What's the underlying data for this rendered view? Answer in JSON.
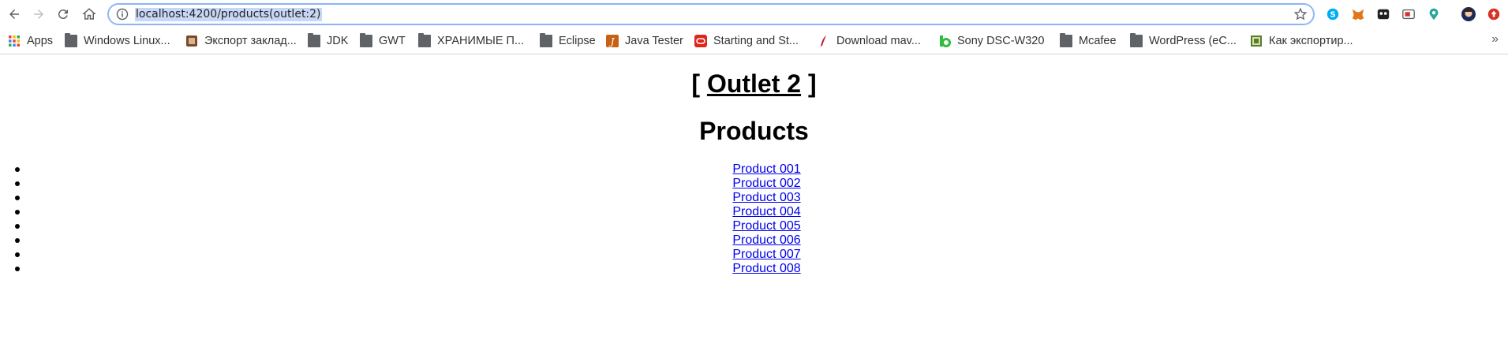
{
  "browser": {
    "url": "localhost:4200/products(outlet:2)",
    "bookmarks": [
      {
        "label": "Apps",
        "icon": "apps-grid-icon"
      },
      {
        "label": "Windows Linux...",
        "icon": "folder-icon"
      },
      {
        "label": "Экспорт заклад...",
        "icon": "bookmark-favicon-icon"
      },
      {
        "label": "JDK",
        "icon": "folder-icon"
      },
      {
        "label": "GWT",
        "icon": "folder-icon"
      },
      {
        "label": "ХРАНИМЫЕ П...",
        "icon": "folder-icon"
      },
      {
        "label": "Eclipse",
        "icon": "folder-icon"
      },
      {
        "label": "Java Tester",
        "icon": "java-favicon-icon"
      },
      {
        "label": "Starting and St...",
        "icon": "oracle-favicon-icon"
      },
      {
        "label": "Download mav...",
        "icon": "maven-favicon-icon"
      },
      {
        "label": "Sony DSC-W320",
        "icon": "site-favicon-icon"
      },
      {
        "label": "Mcafee",
        "icon": "folder-icon"
      },
      {
        "label": "WordPress (eC...",
        "icon": "folder-icon"
      },
      {
        "label": "Как экспортир...",
        "icon": "site-favicon-icon"
      }
    ],
    "colors": {
      "accent": "#8ab4f8",
      "link": "#0000ee"
    }
  },
  "page": {
    "outlet_prefix": "[",
    "outlet_link": "Outlet 2",
    "outlet_suffix": "]",
    "heading": "Products",
    "products": [
      "Product 001",
      "Product 002",
      "Product 003",
      "Product 004",
      "Product 005",
      "Product 006",
      "Product 007",
      "Product 008"
    ]
  }
}
